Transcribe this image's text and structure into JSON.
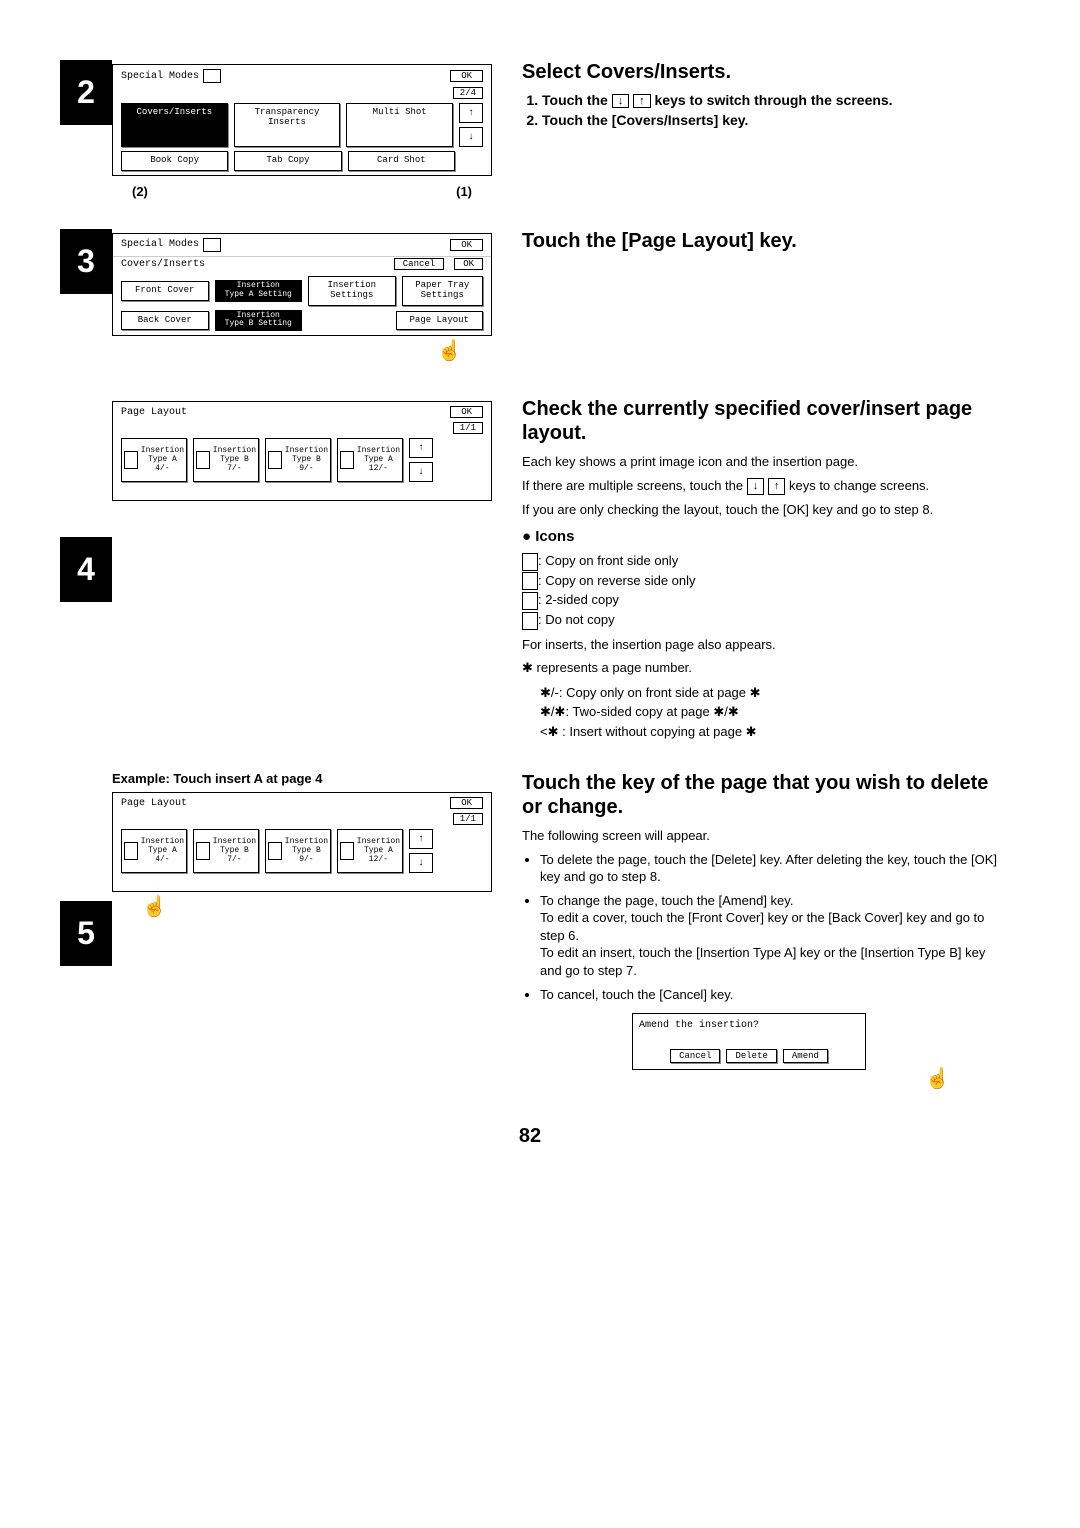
{
  "page_number": "82",
  "step2": {
    "num": "2",
    "heading": "Select Covers/Inserts.",
    "list": [
      "Touch the ↓ ↑ keys to switch through the screens.",
      "Touch the [Covers/Inserts] key."
    ],
    "cap_left": "(2)",
    "cap_right": "(1)",
    "screen": {
      "title": "Special Modes",
      "ok": "OK",
      "page": "2/4",
      "row1": [
        "Covers/Inserts",
        "Transparency\nInserts",
        "Multi Shot"
      ],
      "row2": [
        "Book Copy",
        "Tab Copy",
        "Card Shot"
      ]
    }
  },
  "step3": {
    "num": "3",
    "heading": "Touch the [Page Layout] key.",
    "screen": {
      "title": "Special Modes",
      "ok": "OK",
      "sub": "Covers/Inserts",
      "cancel": "Cancel",
      "subok": "OK",
      "front": "Front Cover",
      "back": "Back Cover",
      "itA": "Insertion\nType A Setting",
      "itB": "Insertion\nType B Setting",
      "ins": "Insertion\nSettings",
      "tray": "Paper Tray\nSettings",
      "layout": "Page Layout"
    }
  },
  "step4": {
    "num": "4",
    "heading": "Check the currently specified cover/insert page layout.",
    "p1": "Each key shows a print image icon and the insertion page.",
    "p2a": "If there are multiple screens, touch the ",
    "p2b": " keys to change screens.",
    "p3": "If you are only checking the layout, touch the [OK] key and go to step 8.",
    "iconhdr": "Icons",
    "icons": [
      ": Copy on front side only",
      ": Copy on reverse side only",
      ": 2-sided copy",
      ": Do not copy"
    ],
    "p4": "For inserts, the insertion page also appears.",
    "p5": " represents a page number.",
    "ex1": "/-: Copy only on front side at page ",
    "ex2a": "/",
    "ex2b": ": Two-sided copy at page ",
    "ex2c": "/",
    "ex3a": "<",
    "ex3b": " : Insert without copying at page ",
    "screen": {
      "title": "Page Layout",
      "ok": "OK",
      "page": "1/1",
      "items": [
        {
          "l1": "Insertion",
          "l2": "Type A",
          "l3": "4/-"
        },
        {
          "l1": "Insertion",
          "l2": "Type B",
          "l3": "7/-"
        },
        {
          "l1": "Insertion",
          "l2": "Type B",
          "l3": "9/-"
        },
        {
          "l1": "Insertion",
          "l2": "Type A",
          "l3": "12/-"
        }
      ]
    }
  },
  "step5": {
    "num": "5",
    "heading": "Touch the key of the page that you wish to delete or change.",
    "example": "Example: Touch insert A at page 4",
    "p1": "The following screen will appear.",
    "b1": "To delete the page, touch the [Delete] key. After deleting the key, touch the [OK] key and go to step 8.",
    "b2a": "To change the page, touch the [Amend] key.",
    "b2b": "To edit a cover, touch the [Front Cover] key or the [Back Cover] key and go to step 6.",
    "b2c": "To edit an insert, touch the [Insertion Type A] key or the [Insertion Type B] key and go to step 7.",
    "b3": "To cancel, touch the [Cancel] key.",
    "dialog": {
      "q": "Amend the insertion?",
      "cancel": "Cancel",
      "delete": "Delete",
      "amend": "Amend"
    },
    "screen": {
      "title": "Page Layout",
      "ok": "OK",
      "page": "1/1",
      "items": [
        {
          "l1": "Insertion",
          "l2": "Type A",
          "l3": "4/-"
        },
        {
          "l1": "Insertion",
          "l2": "Type B",
          "l3": "7/-"
        },
        {
          "l1": "Insertion",
          "l2": "Type B",
          "l3": "9/-"
        },
        {
          "l1": "Insertion",
          "l2": "Type A",
          "l3": "12/-"
        }
      ]
    }
  }
}
